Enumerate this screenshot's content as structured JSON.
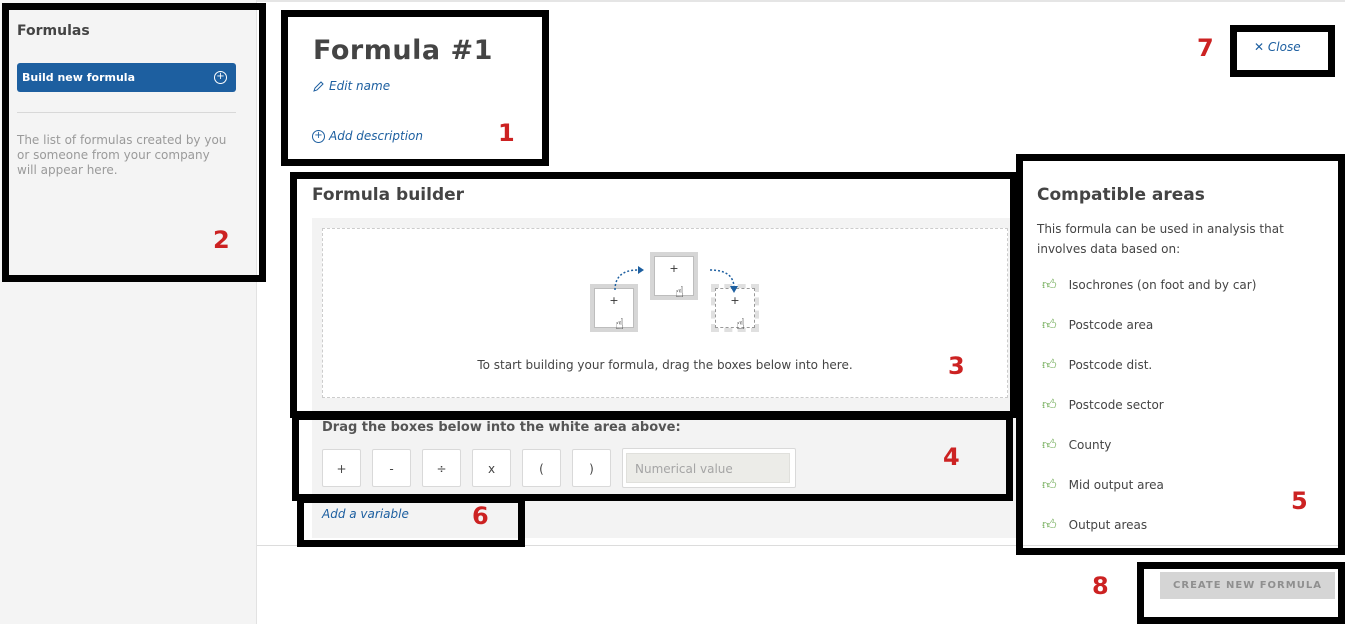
{
  "sidebar": {
    "title": "Formulas",
    "build_button": "Build new formula",
    "hint": "The list of formulas created by you or someone from your company will appear here."
  },
  "header": {
    "formula_name": "Formula #1",
    "edit_name": "Edit name",
    "add_description": "Add description",
    "close": "Close"
  },
  "builder": {
    "title": "Formula builder",
    "drop_hint": "To start building your formula, drag the boxes below into here.",
    "drag_label": "Drag the boxes below into the white area above:",
    "operators": [
      "+",
      "-",
      "÷",
      "x",
      "(",
      ")"
    ],
    "numeric_placeholder": "Numerical value",
    "add_variable": "Add a variable",
    "demo_box_symbol": "+"
  },
  "compatible": {
    "title": "Compatible areas",
    "description": "This formula can be used in analysis that involves data based on:",
    "items": [
      "Isochrones (on foot and by car)",
      "Postcode area",
      "Postcode dist.",
      "Postcode sector",
      "County",
      "Mid output area",
      "Output areas"
    ]
  },
  "footer": {
    "create_button": "CREATE NEW FORMULA"
  },
  "annotations": [
    "1",
    "2",
    "3",
    "4",
    "5",
    "6",
    "7",
    "8"
  ],
  "colors": {
    "accent": "#1d5fa0",
    "annotation": "#cc2222",
    "thumb": "#6aa84f"
  }
}
